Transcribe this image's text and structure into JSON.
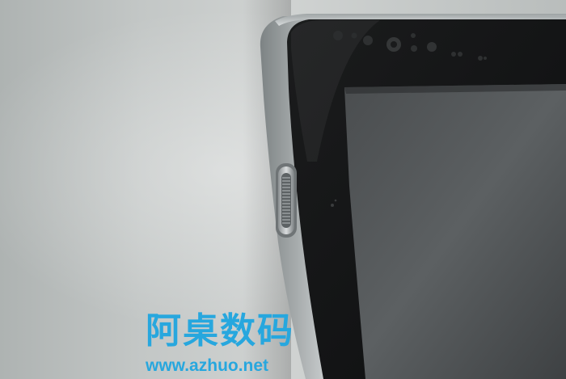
{
  "watermark": {
    "title": "阿桌数码",
    "url": "www.azhuo.net"
  }
}
